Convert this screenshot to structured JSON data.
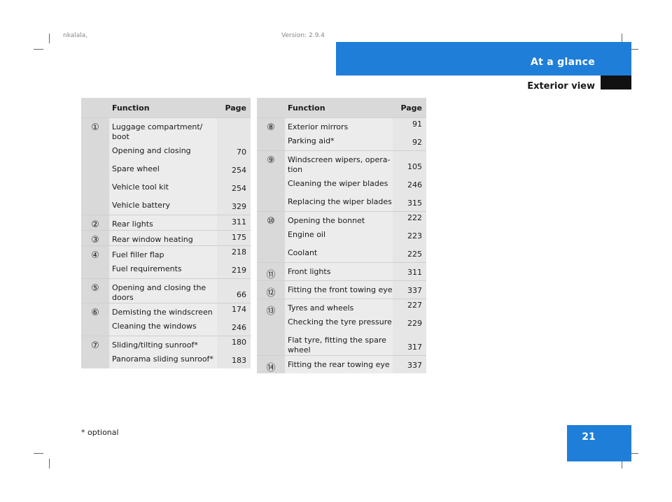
{
  "header": {
    "meta_left": "nkalala,",
    "meta_right": "Version: 2.9.4",
    "section": "At a glance",
    "title": "Exterior view"
  },
  "footer": {
    "footnote": "* optional",
    "page_number": "21"
  },
  "columns": {
    "function": "Function",
    "page": "Page"
  },
  "left_table": [
    {
      "num": "①",
      "items": [
        {
          "label": "Luggage compartment/\nboot",
          "page": ""
        },
        {
          "label": "Opening and closing",
          "page": "70"
        },
        {
          "label": "Spare wheel",
          "page": "254"
        },
        {
          "label": "Vehicle tool kit",
          "page": "254"
        },
        {
          "label": "Vehicle battery",
          "page": "329"
        }
      ]
    },
    {
      "num": "②",
      "items": [
        {
          "label": "Rear lights",
          "page": "311"
        }
      ]
    },
    {
      "num": "③",
      "items": [
        {
          "label": "Rear window heating",
          "page": "175"
        }
      ]
    },
    {
      "num": "④",
      "items": [
        {
          "label": "Fuel filler flap",
          "page": "218"
        },
        {
          "label": "Fuel requirements",
          "page": "219"
        }
      ]
    },
    {
      "num": "⑤",
      "items": [
        {
          "label": "Opening and closing the\ndoors",
          "page": "66"
        }
      ]
    },
    {
      "num": "⑥",
      "items": [
        {
          "label": "Demisting the windscreen",
          "page": "174"
        },
        {
          "label": "Cleaning the windows",
          "page": "246"
        }
      ]
    },
    {
      "num": "⑦",
      "items": [
        {
          "label": "Sliding/tilting sunroof*",
          "page": "180"
        },
        {
          "label": "Panorama sliding sunroof*",
          "page": "183"
        }
      ]
    }
  ],
  "right_table": [
    {
      "num": "⑧",
      "items": [
        {
          "label": "Exterior mirrors",
          "page": "91"
        },
        {
          "label": "Parking aid*",
          "page": "92"
        }
      ]
    },
    {
      "num": "⑨",
      "items": [
        {
          "label": "Windscreen wipers, opera-\ntion",
          "page": "105"
        },
        {
          "label": "Cleaning the wiper blades",
          "page": "246"
        },
        {
          "label": "Replacing the wiper blades",
          "page": "315"
        }
      ]
    },
    {
      "num": "⑩",
      "items": [
        {
          "label": "Opening the bonnet",
          "page": "222"
        },
        {
          "label": "Engine oil",
          "page": "223"
        },
        {
          "label": "Coolant",
          "page": "225"
        }
      ]
    },
    {
      "num": "⑪",
      "items": [
        {
          "label": "Front lights",
          "page": "311"
        }
      ]
    },
    {
      "num": "⑫",
      "items": [
        {
          "label": "Fitting the front towing eye",
          "page": "337"
        }
      ]
    },
    {
      "num": "⑬",
      "items": [
        {
          "label": "Tyres and wheels",
          "page": "227"
        },
        {
          "label": "Checking the tyre pressure",
          "page": "229"
        },
        {
          "label": "Flat tyre, fitting the spare\nwheel",
          "page": "317"
        }
      ]
    },
    {
      "num": "⑭",
      "items": [
        {
          "label": "Fitting the rear towing eye",
          "page": "337"
        }
      ]
    }
  ]
}
